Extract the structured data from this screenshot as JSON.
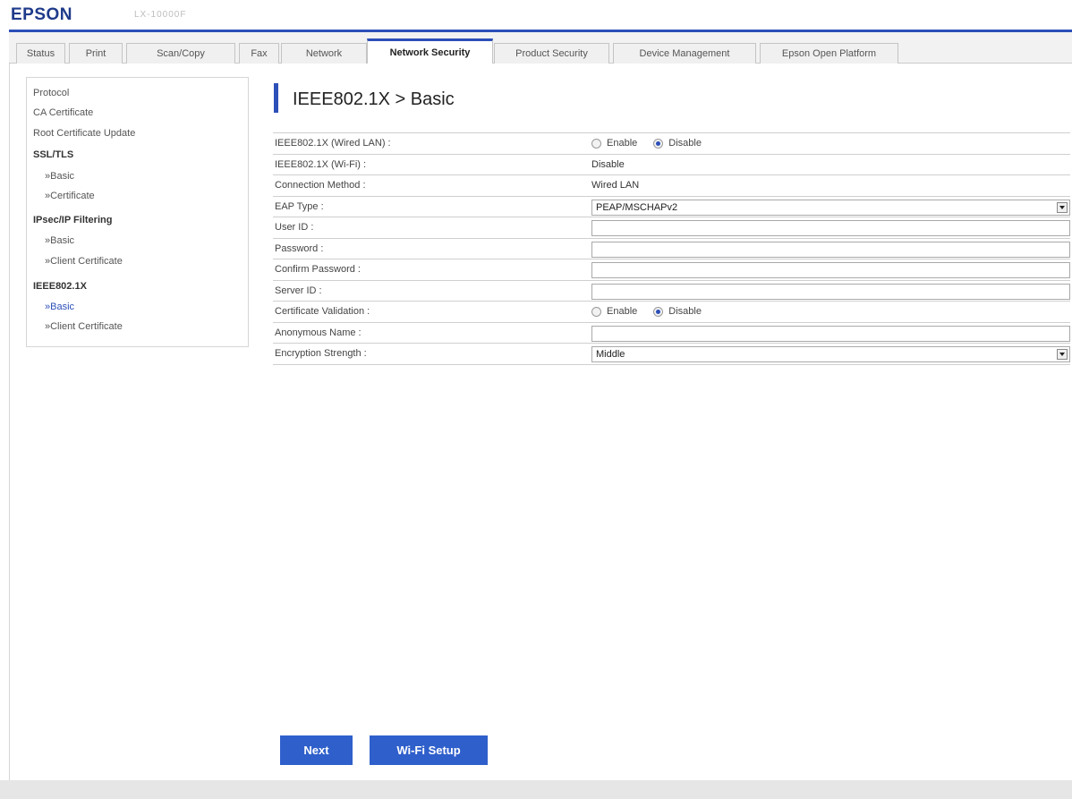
{
  "header": {
    "brand": "EPSON",
    "model": "LX-10000F"
  },
  "tabs": [
    {
      "label": "Status"
    },
    {
      "label": "Print"
    },
    {
      "label": "Scan/Copy"
    },
    {
      "label": "Fax"
    },
    {
      "label": "Network"
    },
    {
      "label": "Network Security",
      "active": true
    },
    {
      "label": "Product Security"
    },
    {
      "label": "Device Management"
    },
    {
      "label": "Epson Open Platform"
    }
  ],
  "sidebar": {
    "items": [
      {
        "label": "Protocol",
        "type": "link"
      },
      {
        "label": "CA Certificate",
        "type": "link"
      },
      {
        "label": "Root Certificate Update",
        "type": "link"
      },
      {
        "label": "SSL/TLS",
        "type": "heading"
      },
      {
        "label": "»Basic",
        "type": "sub"
      },
      {
        "label": "»Certificate",
        "type": "sub"
      },
      {
        "label": "IPsec/IP Filtering",
        "type": "heading"
      },
      {
        "label": "»Basic",
        "type": "sub"
      },
      {
        "label": "»Client Certificate",
        "type": "sub"
      },
      {
        "label": "IEEE802.1X",
        "type": "heading"
      },
      {
        "label": "»Basic",
        "type": "sub",
        "active": true
      },
      {
        "label": "»Client Certificate",
        "type": "sub"
      }
    ]
  },
  "page": {
    "title": "IEEE802.1X > Basic"
  },
  "form": {
    "wired_lan": {
      "label": "IEEE802.1X (Wired LAN) :",
      "enable": "Enable",
      "disable": "Disable",
      "selected": "disable"
    },
    "wifi": {
      "label": "IEEE802.1X (Wi-Fi) :",
      "value": "Disable"
    },
    "connection_method": {
      "label": "Connection Method :",
      "value": "Wired LAN"
    },
    "eap_type": {
      "label": "EAP Type :",
      "value": "PEAP/MSCHAPv2"
    },
    "user_id": {
      "label": "User ID :",
      "value": ""
    },
    "password": {
      "label": "Password :",
      "value": ""
    },
    "confirm_password": {
      "label": "Confirm Password :",
      "value": ""
    },
    "server_id": {
      "label": "Server ID :",
      "value": ""
    },
    "cert_validation": {
      "label": "Certificate Validation :",
      "enable": "Enable",
      "disable": "Disable",
      "selected": "disable"
    },
    "anonymous_name": {
      "label": "Anonymous Name :",
      "value": ""
    },
    "encryption_strength": {
      "label": "Encryption Strength :",
      "value": "Middle"
    }
  },
  "buttons": {
    "next": "Next",
    "wifi_setup": "Wi-Fi Setup"
  },
  "colors": {
    "accent": "#2c4fb8",
    "button": "#2f5fcb",
    "brand": "#1e3a8a"
  }
}
